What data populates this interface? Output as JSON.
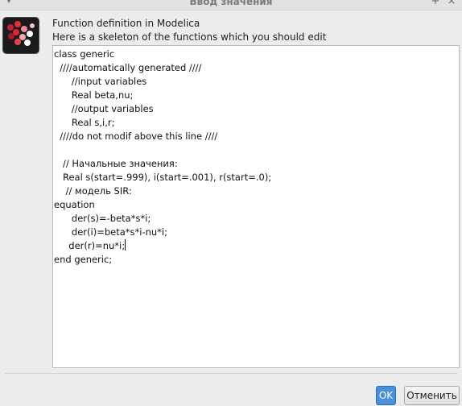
{
  "window": {
    "title": "Ввод значения",
    "menu_glyph": "▾",
    "pin_glyph": "+",
    "close_glyph": "×"
  },
  "header": {
    "title": "Function definition in Modelica",
    "subtitle": "Here is a skeleton of the functions which you should edit"
  },
  "editor": {
    "lines": [
      "class generic",
      "  ////automatically generated ////",
      "      //input variables",
      "      Real beta,nu;",
      "      //output variables",
      "      Real s,i,r;",
      "  ////do not modif above this line ////",
      "",
      "   // Начальные значения:",
      "   Real s(start=.999), i(start=.001), r(start=.0);",
      "    // модель SIR:",
      "equation",
      "      der(s)=-beta*s*i;",
      "      der(i)=beta*s*i-nu*i;",
      "     der(r)=nu*i;",
      "end generic;"
    ],
    "caret_line": 14
  },
  "buttons": {
    "ok_label": "OK",
    "cancel_label": "Отменить"
  },
  "icons": {
    "app": "scilab-xcos-icon",
    "menu": "chevron-down-icon",
    "pin": "pin-icon",
    "close": "close-icon"
  },
  "colors": {
    "accent": "#4a90d9",
    "dot_red": "#d8283a",
    "dot_pink": "#f4a6b0",
    "dot_white": "#ffffff"
  }
}
